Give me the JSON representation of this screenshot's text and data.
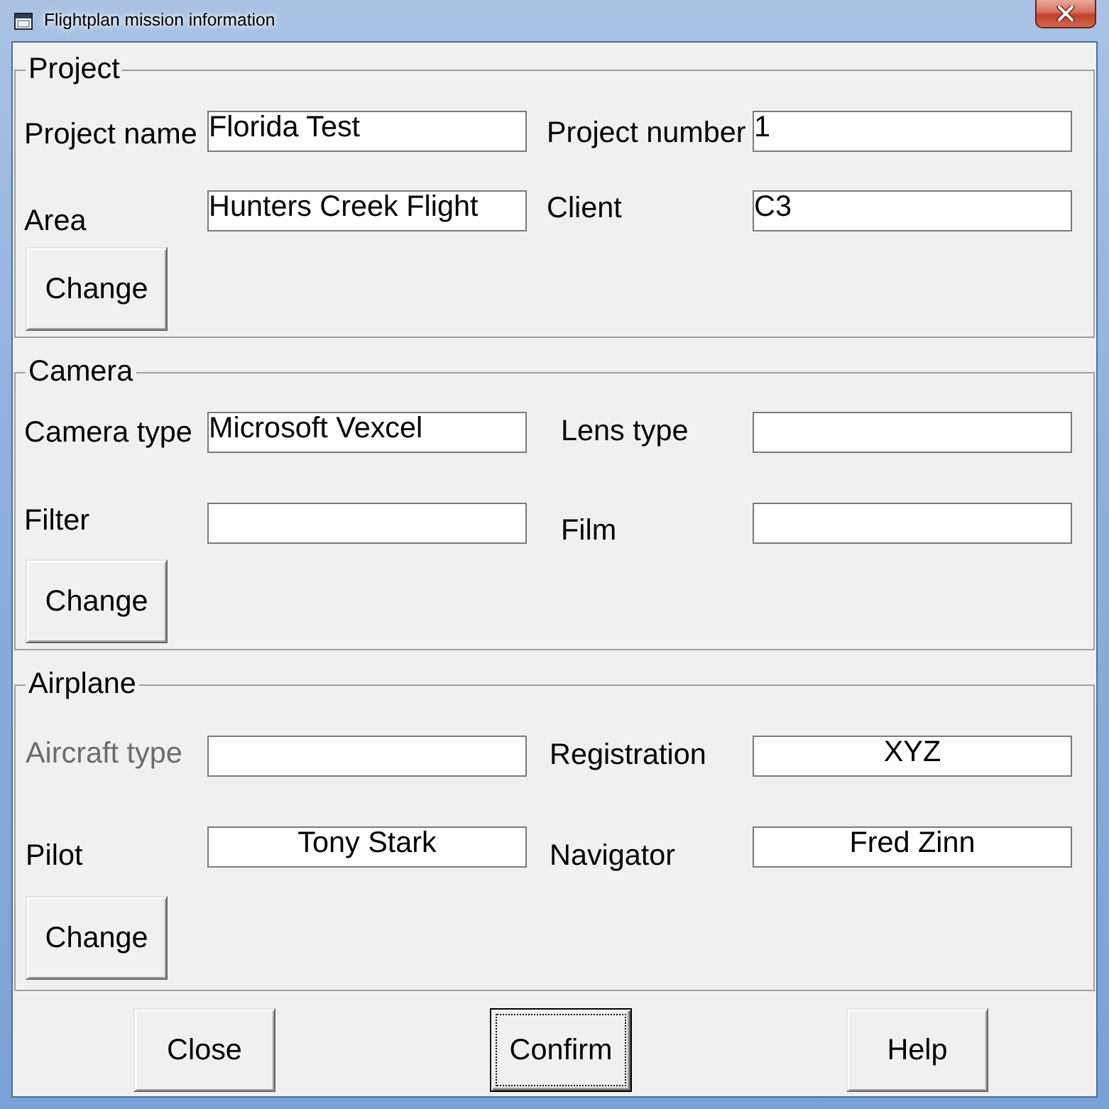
{
  "window": {
    "title": "Flightplan mission information"
  },
  "groups": [
    {
      "title": "Project",
      "values_centered": false,
      "fields": [
        {
          "label": "Project name",
          "value": "Florida Test",
          "disabled": false
        },
        {
          "label": "Project number",
          "value": "1",
          "disabled": false
        },
        {
          "label": "Area",
          "value": "Hunters Creek Flight",
          "disabled": false
        },
        {
          "label": "Client",
          "value": "C3",
          "disabled": false
        }
      ],
      "button": "Change"
    },
    {
      "title": "Camera",
      "values_centered": false,
      "fields": [
        {
          "label": "Camera type",
          "value": "Microsoft Vexcel",
          "disabled": false
        },
        {
          "label": "Lens type",
          "disabled": false
        },
        {
          "label": "Filter",
          "disabled": false
        },
        {
          "label": "Film",
          "disabled": false
        }
      ],
      "button": "Change"
    },
    {
      "title": "Airplane",
      "values_centered": true,
      "fields": [
        {
          "label": "Aircraft type",
          "disabled": true
        },
        {
          "label": "Registration",
          "value": "XYZ",
          "disabled": false
        },
        {
          "label": "Pilot",
          "value": "Tony Stark",
          "disabled": false
        },
        {
          "label": "Navigator",
          "value": "Fred Zinn",
          "disabled": false
        }
      ],
      "button": "Change"
    }
  ],
  "buttons": [
    {
      "label": "Close",
      "focused": false
    },
    {
      "label": "Confirm",
      "focused": true
    },
    {
      "label": "Help",
      "focused": false
    }
  ]
}
